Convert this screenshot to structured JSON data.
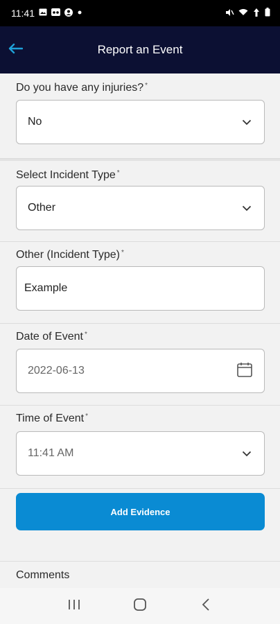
{
  "status_bar": {
    "time": "11:41",
    "left_icons": [
      "image-icon",
      "voicemail-icon",
      "account-icon",
      "dot-icon"
    ],
    "right_icons": [
      "mute-icon",
      "wifi-icon",
      "signal-icon",
      "battery-icon"
    ]
  },
  "header": {
    "title": "Report an Event",
    "back_icon": "arrow-left-icon"
  },
  "form": {
    "injuries": {
      "label": "Do you have any injuries?",
      "required_mark": "*",
      "value": "No"
    },
    "incident_type": {
      "label": "Select Incident Type",
      "required_mark": "*",
      "value": "Other"
    },
    "other_incident_type": {
      "label": "Other (Incident Type)",
      "required_mark": "*",
      "value": "Example"
    },
    "date_of_event": {
      "label": "Date of Event",
      "required_mark": "*",
      "value": "2022-06-13"
    },
    "time_of_event": {
      "label": "Time of Event",
      "required_mark": "*",
      "value": "11:41 AM"
    },
    "add_evidence_label": "Add Evidence",
    "comments_label": "Comments"
  },
  "nav_bar": {
    "items": [
      "recent-apps-icon",
      "home-icon",
      "back-icon"
    ]
  },
  "colors": {
    "header_bg": "#0c1033",
    "accent": "#0a8bd3",
    "back_arrow": "#1fa0d8"
  }
}
